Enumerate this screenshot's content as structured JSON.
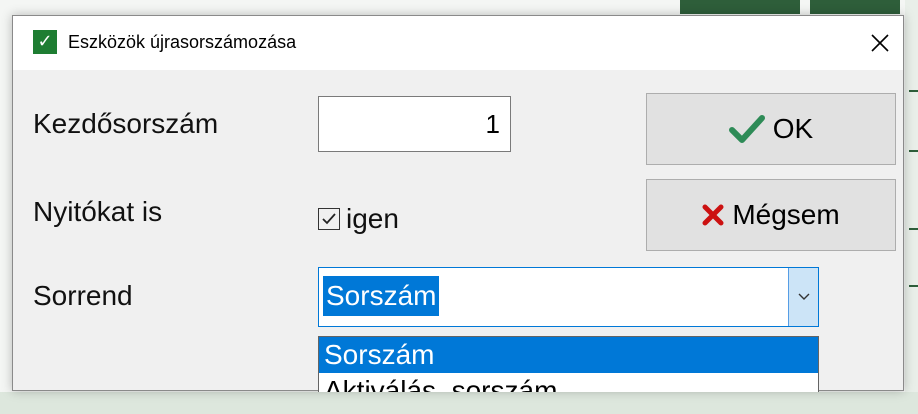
{
  "dialog": {
    "title": "Eszközök újrasorszámozása",
    "app_icon": "checkmark-icon",
    "close_icon": "close-icon"
  },
  "form": {
    "start_number": {
      "label": "Kezdősorszám",
      "value": "1"
    },
    "include_openers": {
      "label": "Nyitókat is",
      "checkbox_label": "igen",
      "checked": true
    },
    "order": {
      "label": "Sorrend",
      "selected": "Sorszám",
      "options": [
        "Sorszám",
        "Aktiválás, sorszám"
      ]
    }
  },
  "buttons": {
    "ok": {
      "label": "OK",
      "icon": "green-checkmark-icon"
    },
    "cancel": {
      "label": "Mégsem",
      "icon": "red-x-icon"
    }
  },
  "colors": {
    "accent": "#0078d7",
    "ok_icon": "#2e8b57",
    "cancel_icon": "#cc1111",
    "app_icon_bg": "#1e7d32"
  }
}
